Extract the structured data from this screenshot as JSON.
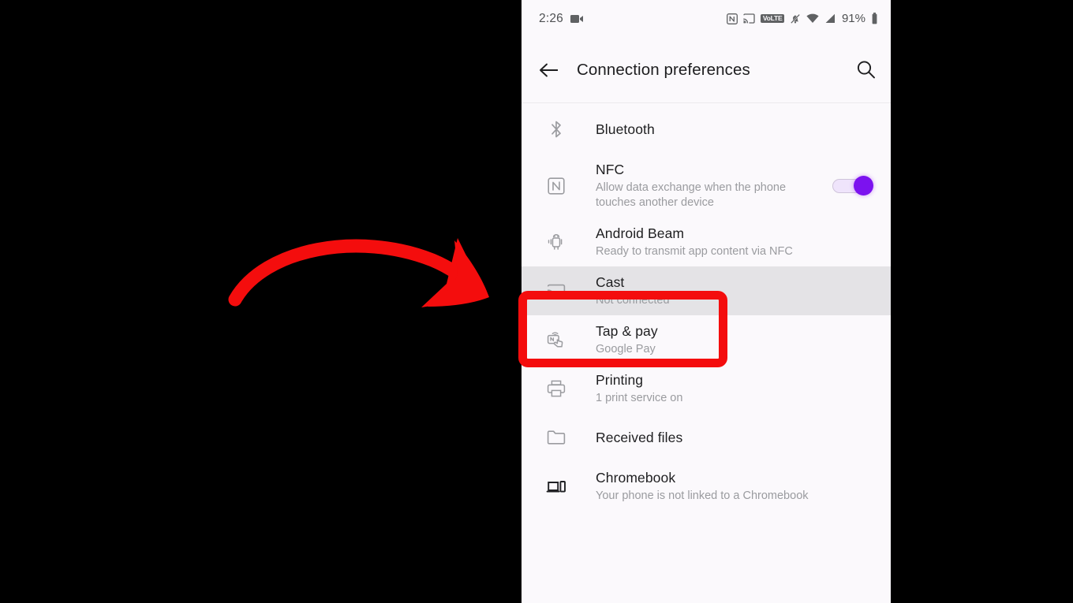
{
  "statusbar": {
    "time": "2:26",
    "left_icons": [
      "screen-record-icon"
    ],
    "right_icons": [
      "nfc-icon",
      "cast-icon",
      "volte-icon",
      "notifications-muted-icon",
      "wifi-icon",
      "cellular-signal-icon"
    ],
    "volte_label": "VoLTE",
    "battery_percent": "91%"
  },
  "appbar": {
    "back_label": "Back",
    "title": "Connection preferences",
    "search_label": "Search"
  },
  "list": {
    "items": [
      {
        "title": "Bluetooth",
        "subtitle": "",
        "icon": "bluetooth-icon",
        "has_toggle": false,
        "highlighted": false
      },
      {
        "title": "NFC",
        "subtitle": "Allow data exchange when the phone touches another device",
        "icon": "nfc-icon",
        "has_toggle": true,
        "toggle_on": true,
        "highlighted": false
      },
      {
        "title": "Android Beam",
        "subtitle": "Ready to transmit app content via NFC",
        "icon": "android-beam-icon",
        "has_toggle": false,
        "highlighted": false
      },
      {
        "title": "Cast",
        "subtitle": "Not connected",
        "icon": "cast-icon",
        "has_toggle": false,
        "highlighted": true
      },
      {
        "title": "Tap & pay",
        "subtitle": "Google Pay",
        "icon": "tap-and-pay-icon",
        "has_toggle": false,
        "highlighted": false
      },
      {
        "title": "Printing",
        "subtitle": "1 print service on",
        "icon": "printer-icon",
        "has_toggle": false,
        "highlighted": false
      },
      {
        "title": "Received files",
        "subtitle": "",
        "icon": "folder-icon",
        "has_toggle": false,
        "highlighted": false
      },
      {
        "title": "Chromebook",
        "subtitle": "Your phone is not linked to a Chromebook",
        "icon": "chromebook-icon",
        "has_toggle": false,
        "highlighted": false
      }
    ]
  },
  "annotations": {
    "highlight_color": "#f40d0d",
    "arrow_color": "#f40d0d",
    "target_item": "Cast",
    "arrow_name": "curved-pointer-arrow"
  },
  "colors": {
    "accent_toggle": "#7c12ef",
    "panel_background": "#fbf9fc",
    "highlight_row": "#e4e3e6",
    "backdrop": "#000000"
  }
}
